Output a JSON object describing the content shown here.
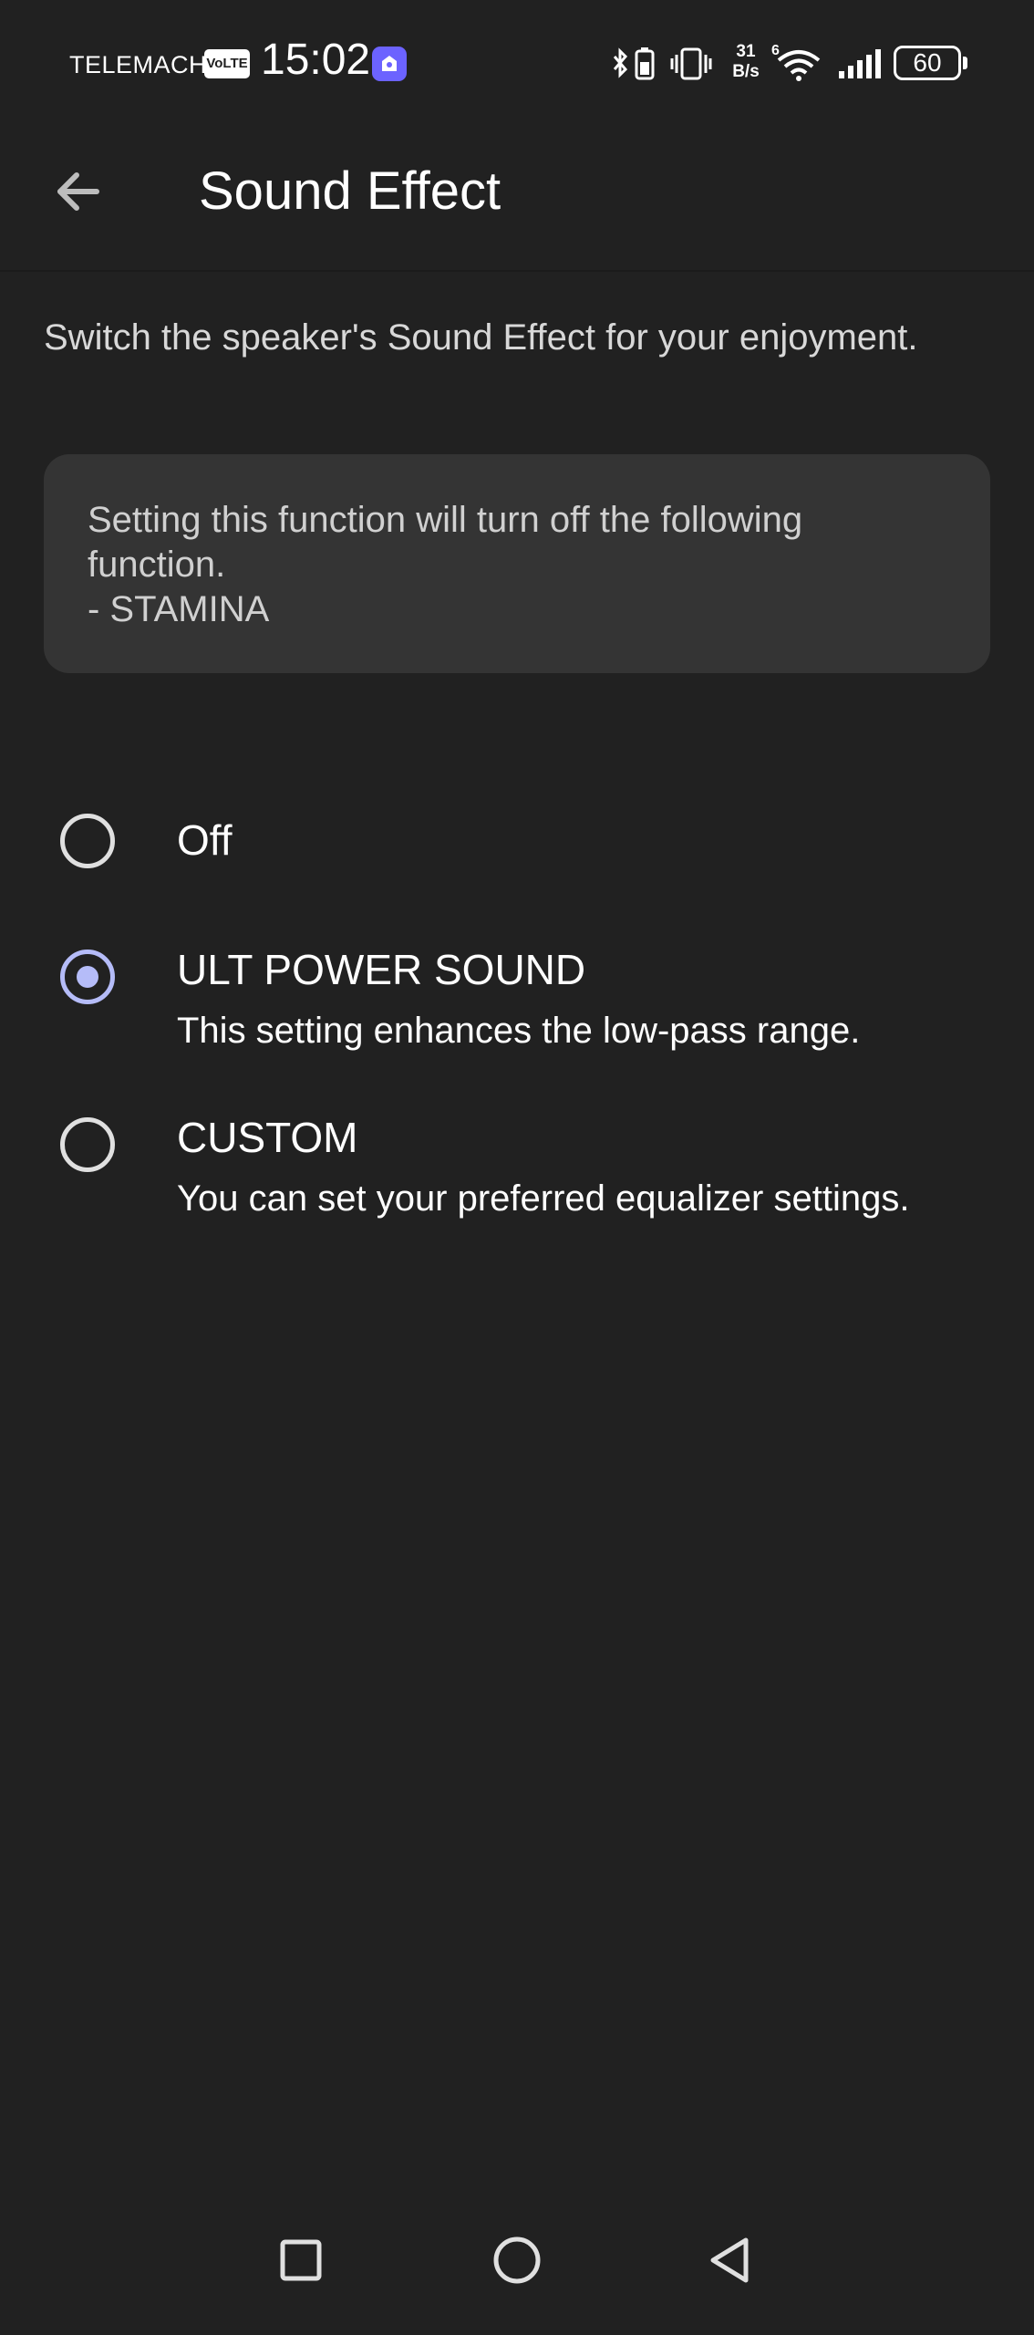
{
  "status_bar": {
    "carrier": "TELEMACH",
    "volte": "VoLTE",
    "time": "15:02",
    "net_speed_value": "31",
    "net_speed_unit": "B/s",
    "signal_generation": "6",
    "battery_level": "60"
  },
  "header": {
    "title": "Sound Effect",
    "back_icon": "arrow-left-icon"
  },
  "description": "Switch the speaker's Sound Effect for your enjoyment.",
  "notice": {
    "text": "Setting this function will turn off the following function.\n- STAMINA"
  },
  "options": [
    {
      "label": "Off",
      "description": "",
      "selected": false
    },
    {
      "label": "ULT POWER SOUND",
      "description": "This setting enhances the low-pass range.",
      "selected": true
    },
    {
      "label": "CUSTOM",
      "description": "You can set your preferred equalizer settings.",
      "selected": false
    }
  ],
  "colors": {
    "background": "#212121",
    "card": "#343434",
    "accent": "#b5bcf8",
    "app_badge": "#6c63ff"
  },
  "nav_bar": {
    "recents_icon": "square-icon",
    "home_icon": "circle-icon",
    "back_icon": "triangle-back-icon"
  }
}
